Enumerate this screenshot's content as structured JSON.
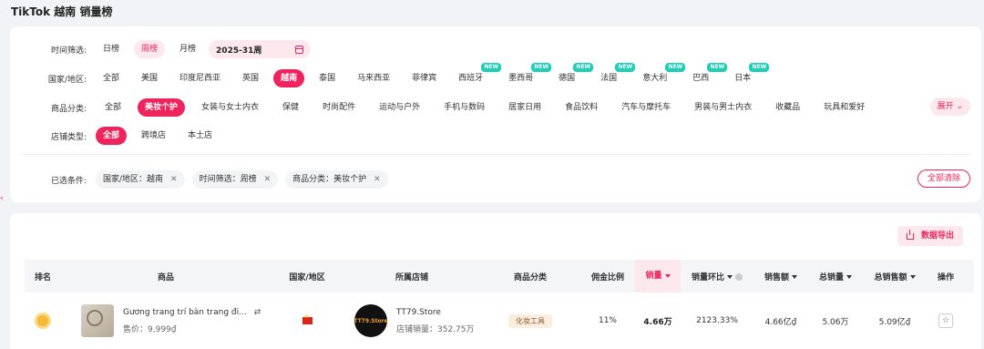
{
  "page_title": "TikTok 越南 销量榜",
  "filters": {
    "time": {
      "label": "时间筛选:",
      "options": [
        "日榜",
        "周榜",
        "月榜"
      ],
      "active": "周榜",
      "date_value": "2025-31周"
    },
    "country": {
      "label": "国家/地区:",
      "options": [
        {
          "name": "全部",
          "new": false
        },
        {
          "name": "美国",
          "new": false
        },
        {
          "name": "印度尼西亚",
          "new": false
        },
        {
          "name": "英国",
          "new": false
        },
        {
          "name": "越南",
          "new": false
        },
        {
          "name": "泰国",
          "new": false
        },
        {
          "name": "马来西亚",
          "new": false
        },
        {
          "name": "菲律宾",
          "new": false
        },
        {
          "name": "西班牙",
          "new": true
        },
        {
          "name": "墨西哥",
          "new": true
        },
        {
          "name": "德国",
          "new": true
        },
        {
          "name": "法国",
          "new": true
        },
        {
          "name": "意大利",
          "new": true
        },
        {
          "name": "巴西",
          "new": true
        },
        {
          "name": "日本",
          "new": true
        }
      ],
      "active": "越南",
      "new_badge": "NEW"
    },
    "category": {
      "label": "商品分类:",
      "options": [
        "全部",
        "美妆个护",
        "女装与女士内衣",
        "保健",
        "时尚配件",
        "运动与户外",
        "手机与数码",
        "居家日用",
        "食品饮料",
        "汽车与摩托车",
        "男装与男士内衣",
        "收藏品",
        "玩具和爱好"
      ],
      "active": "美妆个护",
      "expand_label": "展开"
    },
    "shop_type": {
      "label": "店铺类型:",
      "options": [
        "全部",
        "跨境店",
        "本土店"
      ],
      "active": "全部"
    },
    "selected": {
      "label": "已选条件:",
      "items": [
        "国家/地区：越南",
        "时间筛选：周榜",
        "商品分类：美妆个护"
      ],
      "clear_label": "全部清除"
    }
  },
  "table": {
    "export_label": "数据导出",
    "headers": [
      "排名",
      "商品",
      "国家/地区",
      "所属店铺",
      "商品分类",
      "佣金比例",
      "销量",
      "销量环比",
      "销售额",
      "总销量",
      "总销售额",
      "操作"
    ],
    "rows": [
      {
        "product_name": "Gương trang trí bàn trang đi...",
        "product_price": "售价：9,999₫",
        "shop_name": "TT79.Store",
        "shop_logo_text": "TT79.Store",
        "shop_sales": "店铺销量：352.75万",
        "category": "化妆工具",
        "commission": "11%",
        "sales": "4.66万",
        "sales_mom": "2123.33%",
        "revenue": "4.66亿₫",
        "total_sales": "5.06万",
        "total_revenue": "5.09亿₫"
      }
    ]
  },
  "colors": {
    "accent": "#f0245c",
    "accent_soft": "#fde8ee",
    "new_badge": "#1ccfb6"
  }
}
